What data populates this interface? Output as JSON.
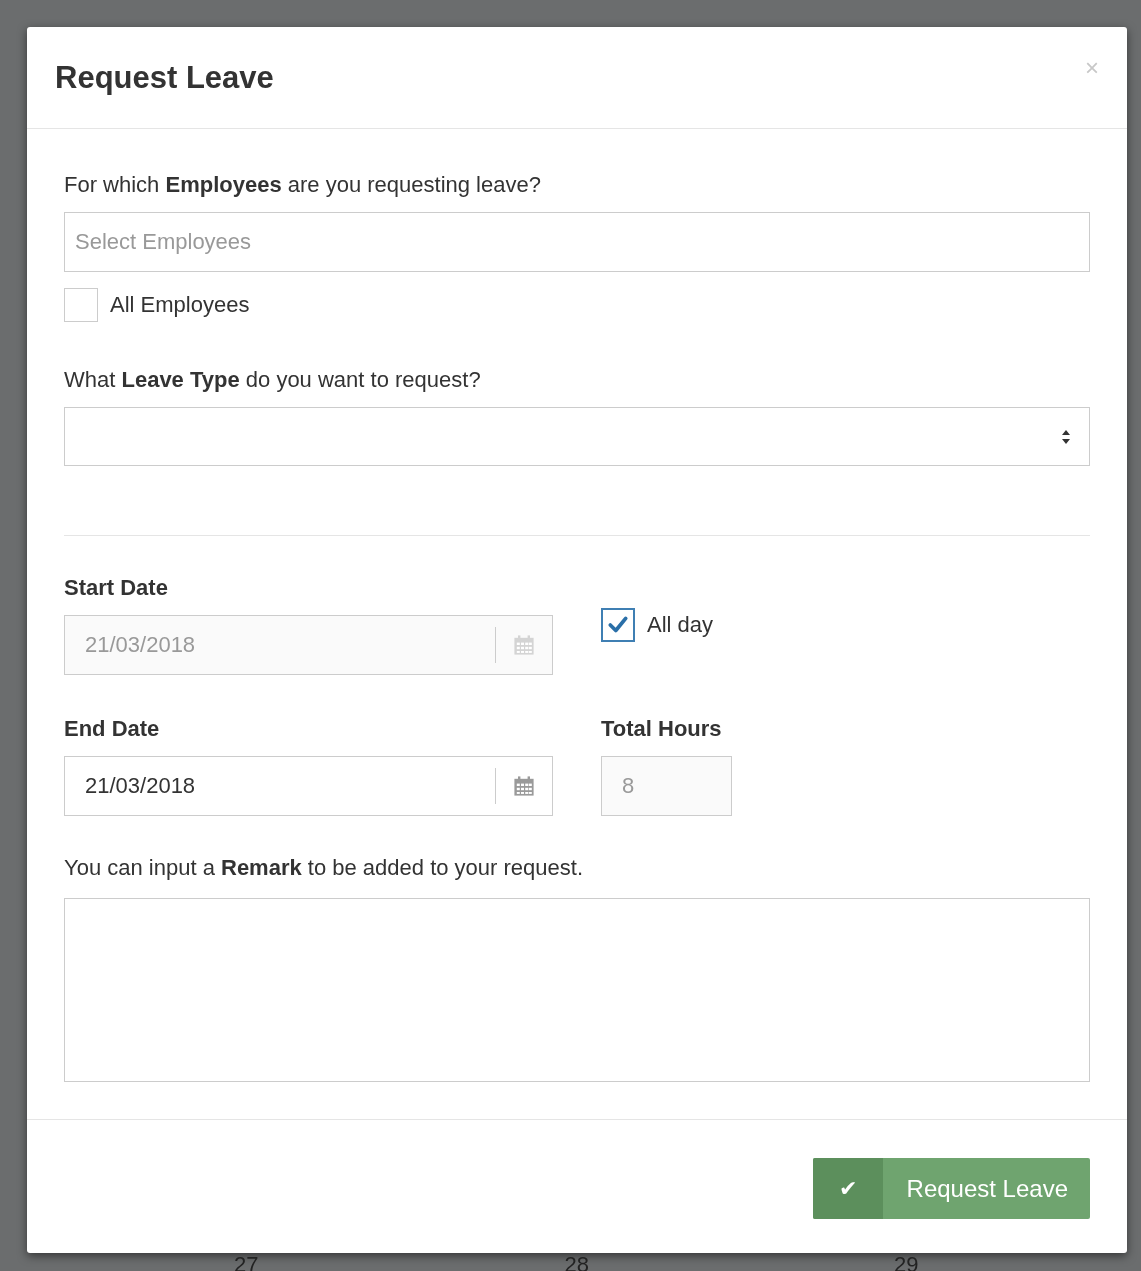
{
  "dialog": {
    "title": "Request Leave",
    "close": "×"
  },
  "employees": {
    "label": "For which **Employees** are you requesting leave?",
    "placeholder": "Select Employees",
    "all_checkbox": {
      "label": "All Employees",
      "checked": false
    }
  },
  "leave_type": {
    "label": "What **Leave Type** do you want to request?"
  },
  "start_date": {
    "label": "Start Date",
    "value": "21/03/2018",
    "disabled": true
  },
  "all_day": {
    "label": "All day",
    "checked": true
  },
  "end_date": {
    "label": "End Date",
    "value": "21/03/2018",
    "disabled": false
  },
  "total_hours": {
    "label": "Total Hours",
    "value": "8",
    "disabled": true
  },
  "remark": {
    "label": "You can input a **Remark** to be added to your request."
  },
  "submit": {
    "icon": "✔",
    "label": "Request Leave"
  },
  "background_days": [
    "27",
    "28",
    "29"
  ]
}
